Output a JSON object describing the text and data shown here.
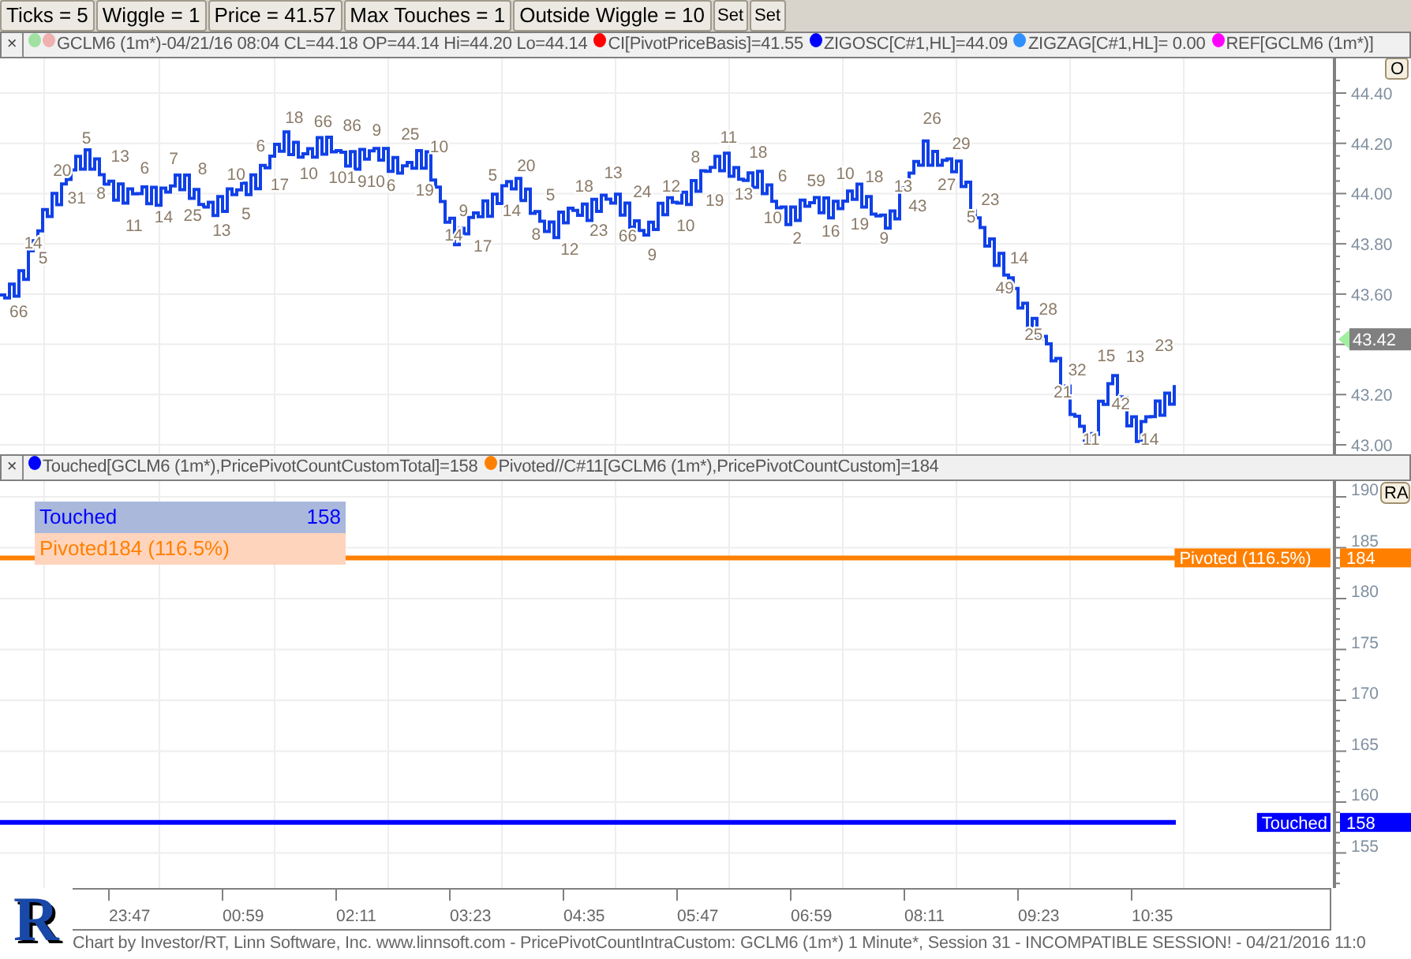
{
  "toolbar": {
    "buttons": [
      "Ticks = 5",
      "Wiggle = 1",
      "Price = 41.57",
      "Max Touches = 1",
      "Outside Wiggle = 10",
      "Set",
      "Set"
    ]
  },
  "price_panel": {
    "close": "×",
    "legend": [
      {
        "color": "#a0e0a0"
      },
      {
        "text": "GCLM6 (1m*)-04/21/16 08:04 CL=44.18 OP=44.14 Hi=44.20 Lo=44.14",
        "color": "#f0b0b0"
      },
      {
        "text": "CI[PivotPriceBasis]=41.55",
        "color": "#ff0000"
      },
      {
        "text": "ZIGOSC[C#1,HL]=44.09",
        "color": "#0000ff"
      },
      {
        "text": "ZIGZAG[C#1,HL]= 0.00",
        "color": "#3090ff"
      },
      {
        "text": "REF[GCLM6 (1m*)]",
        "color": "#ff00ff"
      }
    ],
    "corner_button": "O",
    "axis": [
      "44.40",
      "44.20",
      "44.00",
      "43.80",
      "43.60",
      "43.20",
      "43.00"
    ],
    "last_price": "43.42",
    "pivot_labels": [
      "66",
      "14",
      "5",
      "20",
      "31",
      "5",
      "8",
      "13",
      "11",
      "6",
      "14",
      "7",
      "25",
      "8",
      "13",
      "10",
      "5",
      "6",
      "17",
      "18",
      "10",
      "66",
      "101",
      "86",
      "910",
      "9",
      "6",
      "25",
      "19",
      "10",
      "14",
      "9",
      "17",
      "5",
      "14",
      "20",
      "8",
      "5",
      "12",
      "18",
      "23",
      "13",
      "66",
      "24",
      "9",
      "12",
      "10",
      "8",
      "19",
      "11",
      "13",
      "18",
      "10",
      "6",
      "2",
      "59",
      "16",
      "10",
      "19",
      "18",
      "9",
      "13",
      "43",
      "26",
      "27",
      "29",
      "5",
      "23",
      "49",
      "14",
      "25",
      "28",
      "21",
      "32",
      "11",
      "15",
      "42",
      "13",
      "14",
      "23"
    ]
  },
  "count_panel": {
    "close": "×",
    "legend": [
      {
        "text": "Touched[GCLM6 (1m*),PricePivotCountCustomTotal]=158",
        "color": "#0000ff"
      },
      {
        "text": "Pivoted//C#11[GCLM6 (1m*),PricePivotCountCustom]=184",
        "color": "#ff8000"
      }
    ],
    "corner_button": "RA",
    "summary": [
      {
        "label": "Touched",
        "value": "158"
      },
      {
        "label": "Pivoted184 (116.5%)"
      }
    ],
    "lines": [
      {
        "tag": "Pivoted (116.5%)",
        "value": "184",
        "color": "#ff8000"
      },
      {
        "tag": "Touched",
        "value": "158",
        "color": "#0000ff"
      }
    ],
    "axis": [
      "190",
      "185",
      "180",
      "175",
      "170",
      "165",
      "160",
      "155"
    ]
  },
  "time_axis": [
    "23:47",
    "00:59",
    "02:11",
    "03:23",
    "04:35",
    "05:47",
    "06:59",
    "08:11",
    "09:23",
    "10:35"
  ],
  "logo": "R",
  "footer": "Chart by Investor/RT, Linn Software, Inc. www.linnsoft.com - PricePivotCountIntraCustom: GCLM6 (1m*) 1 Minute*, Session 31 - INCOMPATIBLE SESSION! - 04/21/2016 11:0"
}
